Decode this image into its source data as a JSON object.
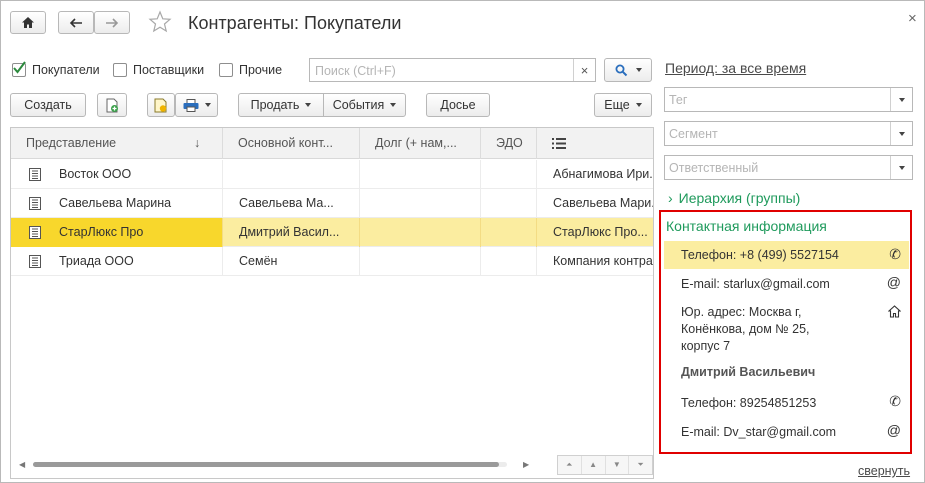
{
  "window": {
    "title": "Контрагенты: Покупатели"
  },
  "filters": {
    "buyers": {
      "label": "Покупатели",
      "checked": true
    },
    "suppliers": {
      "label": "Поставщики",
      "checked": false
    },
    "other": {
      "label": "Прочие",
      "checked": false
    },
    "search_placeholder": "Поиск (Ctrl+F)",
    "clear_symbol": "×"
  },
  "toolbar": {
    "create": "Создать",
    "sell": "Продать",
    "events": "События",
    "dossier": "Досье",
    "more": "Еще"
  },
  "grid": {
    "columns": [
      "Представление",
      "Основной конт...",
      "Долг (+ нам,...",
      "ЭДО"
    ],
    "sort_arrow": "↓",
    "rows": [
      {
        "name": "Восток ООО",
        "contact": "",
        "debt": "",
        "edo": "",
        "extra": "Абнагимова Ири..."
      },
      {
        "name": "Савельева Марина",
        "contact": "Савельева Ма...",
        "debt": "",
        "edo": "",
        "extra": "Савельева Мари..."
      },
      {
        "name": "СтарЛюкс Про",
        "contact": "Дмитрий Васил...",
        "debt": "",
        "edo": "",
        "extra": "СтарЛюкс Про..."
      },
      {
        "name": "Триада ООО",
        "contact": "Семён",
        "debt": "",
        "edo": "",
        "extra": "Компания контра..."
      }
    ],
    "selected_row": 2
  },
  "side": {
    "period": "Период: за все время",
    "tag_placeholder": "Тег",
    "segment_placeholder": "Сегмент",
    "responsible_placeholder": "Ответственный",
    "hierarchy": "Иерархия (группы)",
    "collapse": "свернуть"
  },
  "contacts": {
    "title": "Контактная информация",
    "phone": "Телефон: +8 (499) 5527154",
    "email": "E-mail: starlux@gmail.com",
    "address_line1": "Юр. адрес: Москва г,",
    "address_line2": "Конёнкова, дом № 25,",
    "address_line3": "корпус 7",
    "person": "Дмитрий Васильевич",
    "person_phone": "Телефон: 89254851253",
    "person_email": "E-mail: Dv_star@gmail.com"
  },
  "colors": {
    "accent_green": "#1f9a5c",
    "selection": "#fbeda0",
    "selection_strong": "#f8d72c",
    "highlight_border": "#e00000",
    "search_blue": "#2a6ebd"
  }
}
